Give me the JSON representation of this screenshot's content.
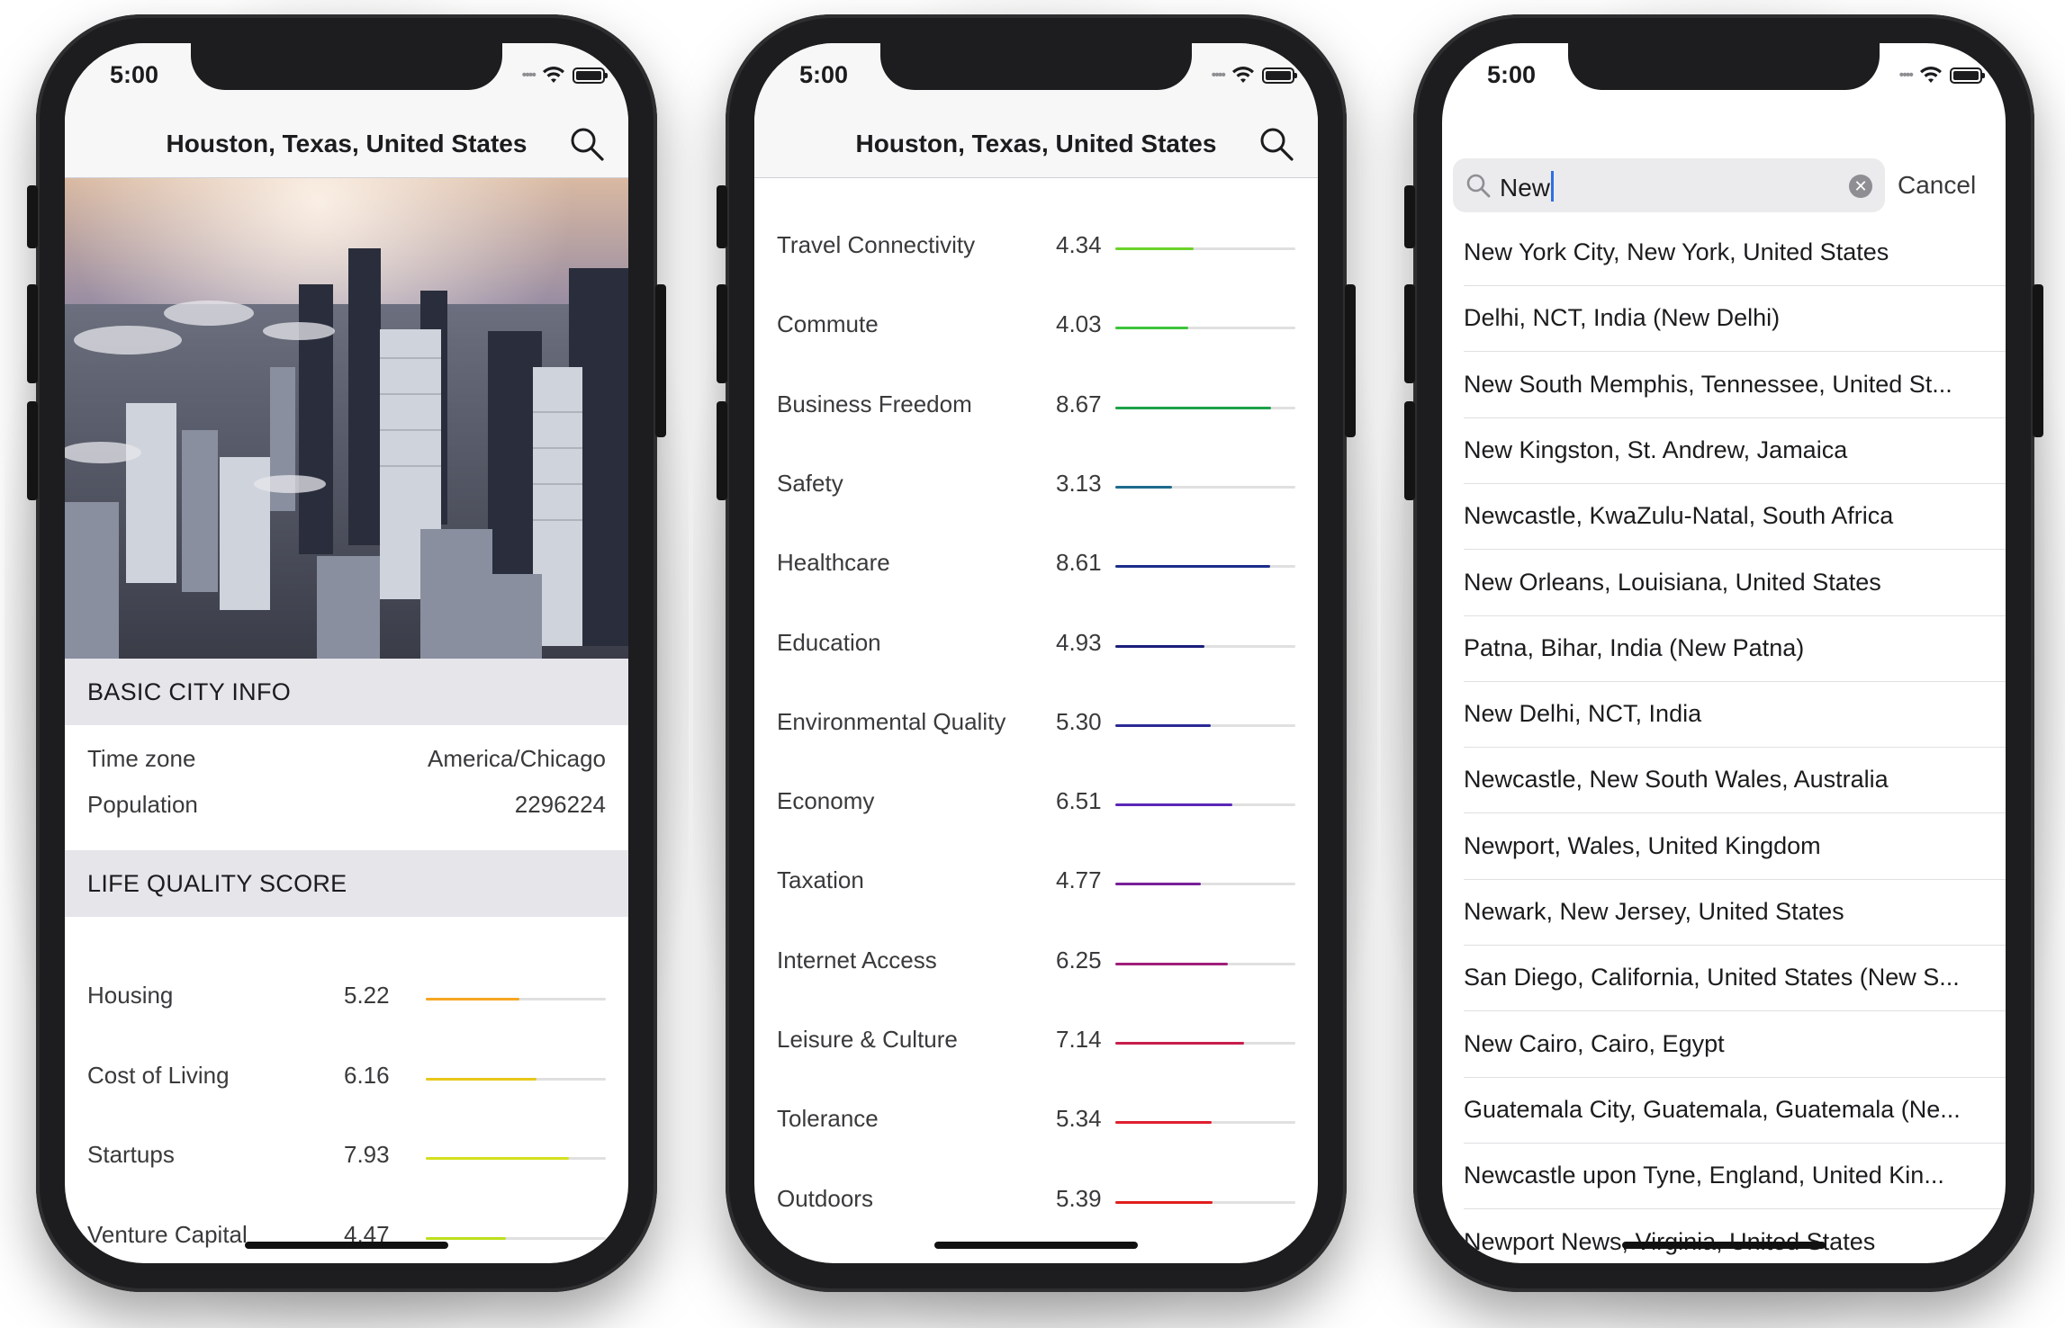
{
  "status": {
    "time": "5:00"
  },
  "city": {
    "title": "Houston, Texas, United States"
  },
  "basic_info": {
    "header": "BASIC CITY INFO",
    "rows": [
      {
        "label": "Time zone",
        "value": "America/Chicago"
      },
      {
        "label": "Population",
        "value": "2296224"
      }
    ]
  },
  "life_quality": {
    "header": "LIFE QUALITY SCORE",
    "scores_screen1": [
      {
        "label": "Housing",
        "value": "5.22",
        "fraction": 0.522,
        "color": "#f5a623"
      },
      {
        "label": "Cost of Living",
        "value": "6.16",
        "fraction": 0.616,
        "color": "#e8c81a"
      },
      {
        "label": "Startups",
        "value": "7.93",
        "fraction": 0.793,
        "color": "#d4e01c"
      },
      {
        "label": "Venture Capital",
        "value": "4.47",
        "fraction": 0.447,
        "color": "#bce01c"
      }
    ],
    "scores_screen2": [
      {
        "label": "Travel Connectivity",
        "value": "4.34",
        "fraction": 0.434,
        "color": "#6bd22a"
      },
      {
        "label": "Commute",
        "value": "4.03",
        "fraction": 0.403,
        "color": "#3ec43a"
      },
      {
        "label": "Business Freedom",
        "value": "8.67",
        "fraction": 0.867,
        "color": "#1ea04a"
      },
      {
        "label": "Safety",
        "value": "3.13",
        "fraction": 0.313,
        "color": "#1e6a8c"
      },
      {
        "label": "Healthcare",
        "value": "8.61",
        "fraction": 0.861,
        "color": "#1a2e8a"
      },
      {
        "label": "Education",
        "value": "4.93",
        "fraction": 0.493,
        "color": "#1a1e7a"
      },
      {
        "label": "Environmental Quality",
        "value": "5.30",
        "fraction": 0.53,
        "color": "#2a2896"
      },
      {
        "label": "Economy",
        "value": "6.51",
        "fraction": 0.651,
        "color": "#5a26b8"
      },
      {
        "label": "Taxation",
        "value": "4.77",
        "fraction": 0.477,
        "color": "#7a1e9a"
      },
      {
        "label": "Internet Access",
        "value": "6.25",
        "fraction": 0.625,
        "color": "#a01e7a"
      },
      {
        "label": "Leisure & Culture",
        "value": "7.14",
        "fraction": 0.714,
        "color": "#c81e4e"
      },
      {
        "label": "Tolerance",
        "value": "5.34",
        "fraction": 0.534,
        "color": "#e01e2e"
      },
      {
        "label": "Outdoors",
        "value": "5.39",
        "fraction": 0.539,
        "color": "#e01e1e"
      }
    ]
  },
  "search": {
    "query": "New",
    "cancel_label": "Cancel",
    "results": [
      "New York City, New York, United States",
      "Delhi, NCT, India (New Delhi)",
      "New South Memphis, Tennessee, United St...",
      "New Kingston, St. Andrew, Jamaica",
      "Newcastle, KwaZulu-Natal, South Africa",
      "New Orleans, Louisiana, United States",
      "Patna, Bihar, India (New Patna)",
      "New Delhi, NCT, India",
      "Newcastle, New South Wales, Australia",
      "Newport, Wales, United Kingdom",
      "Newark, New Jersey, United States",
      "San Diego, California, United States (New S...",
      "New Cairo, Cairo, Egypt",
      "Guatemala City, Guatemala, Guatemala (Ne...",
      "Newcastle upon Tyne, England, United Kin...",
      "Newport News, Virginia, United States"
    ]
  },
  "icons": {
    "search": "search-icon",
    "clear": "clear-icon",
    "wifi": "wifi-icon",
    "battery": "battery-icon",
    "signal": "signal-icon"
  }
}
